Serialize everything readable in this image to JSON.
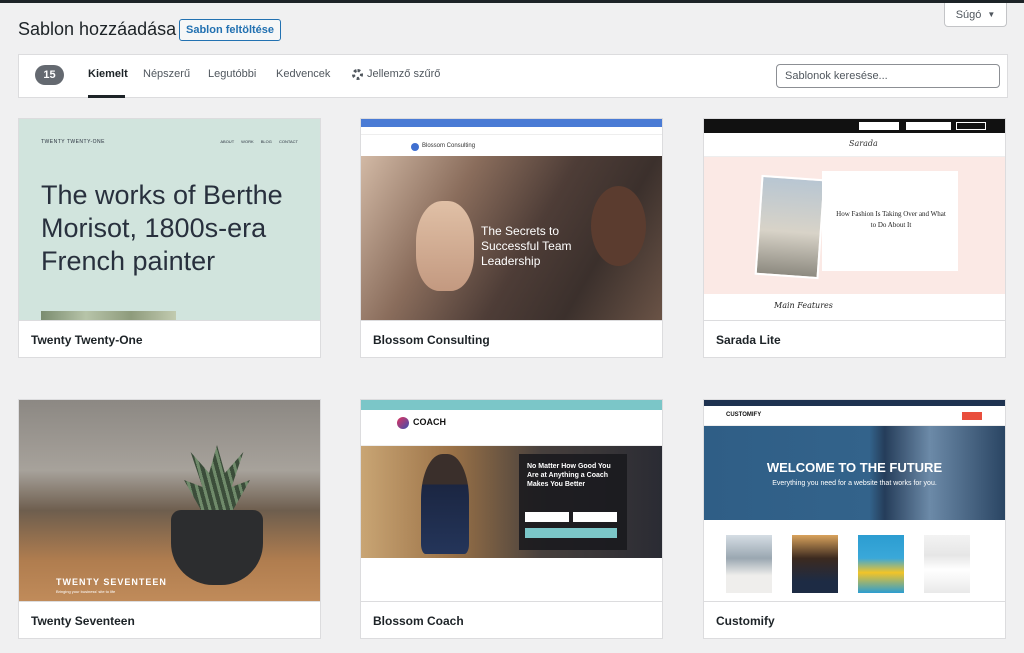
{
  "header": {
    "title": "Sablon hozzáadása",
    "upload_label": "Sablon feltöltése",
    "help_label": "Súgó"
  },
  "filter": {
    "count": "15",
    "tabs": [
      "Kiemelt",
      "Népszerű",
      "Legutóbbi",
      "Kedvencek"
    ],
    "active_tab": "Kiemelt",
    "feature_filter_label": "Jellemző szűrő",
    "search_placeholder": "Sablonok keresése..."
  },
  "themes": [
    {
      "name": "Twenty Twenty-One",
      "preview": {
        "brand": "TWENTY TWENTY-ONE",
        "nav": "ABOUT WORK BLOG CONTACT",
        "headline": "The works of Berthe Morisot, 1800s-era French painter"
      }
    },
    {
      "name": "Blossom Consulting",
      "preview": {
        "logo": "Blossom Consulting",
        "headline": "The Secrets to Successful Team Leadership"
      }
    },
    {
      "name": "Sarada Lite",
      "preview": {
        "logo": "Sarada",
        "headline": "How Fashion Is Taking Over and What to Do About It",
        "section": "Main Features"
      }
    },
    {
      "name": "Twenty Seventeen",
      "preview": {
        "brand": "TWENTY SEVENTEEN",
        "tagline": "Bringing your business' site to life"
      }
    },
    {
      "name": "Blossom Coach",
      "preview": {
        "logo": "COACH",
        "headline": "No Matter How Good You Are at Anything a Coach Makes You Better"
      }
    },
    {
      "name": "Customify",
      "preview": {
        "logo": "CUSTOMIFY",
        "headline": "WELCOME TO THE FUTURE",
        "subline": "Everything you need for a website that works for you."
      }
    }
  ]
}
